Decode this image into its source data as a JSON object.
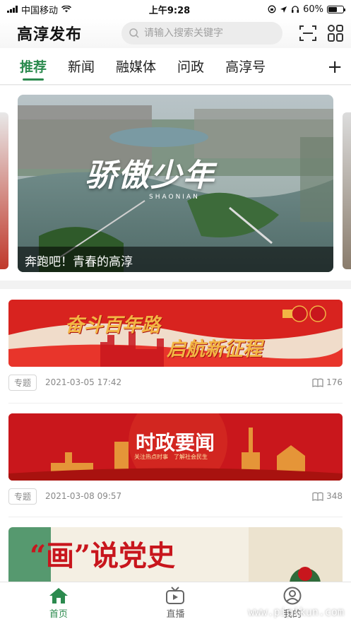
{
  "status_bar": {
    "carrier": "中国移动",
    "time": "上午9:28",
    "battery": "60%",
    "battery_level": 0.6
  },
  "header": {
    "app_title": "高淳发布",
    "search_placeholder": "请输入搜索关键字",
    "icons": [
      "search-icon",
      "scan-icon",
      "grid-menu-icon"
    ]
  },
  "tabs": {
    "items": [
      {
        "label": "推荐",
        "active": true
      },
      {
        "label": "新闻",
        "active": false
      },
      {
        "label": "融媒体",
        "active": false
      },
      {
        "label": "问政",
        "active": false
      },
      {
        "label": "高淳号",
        "active": false
      }
    ],
    "add_label": "+"
  },
  "carousel": {
    "caption": "奔跑吧！青春的高淳",
    "overlay_title": "骄傲少年",
    "overlay_sub": "SHAONIAN"
  },
  "feed": [
    {
      "banner_title": "奋斗百年路",
      "banner_subtitle": "启航新征程",
      "tag": "专题",
      "datetime": "2021-03-05 17:42",
      "views": "176"
    },
    {
      "banner_title": "时政要闻",
      "banner_subtitle": "关注热点时事　了解社会民生",
      "tag": "专题",
      "datetime": "2021-03-08 09:57",
      "views": "348"
    },
    {
      "banner_title": "“画”说党史"
    }
  ],
  "bottom_nav": [
    {
      "label": "首页",
      "icon": "home-icon",
      "active": true
    },
    {
      "label": "直播",
      "icon": "tv-icon",
      "active": false
    },
    {
      "label": "我的",
      "icon": "user-icon",
      "active": false
    }
  ],
  "watermark": "www.pipikun.com",
  "colors": {
    "accent": "#2b8a4e",
    "banner_red": "#c8161d",
    "banner_gold": "#f2b544"
  }
}
